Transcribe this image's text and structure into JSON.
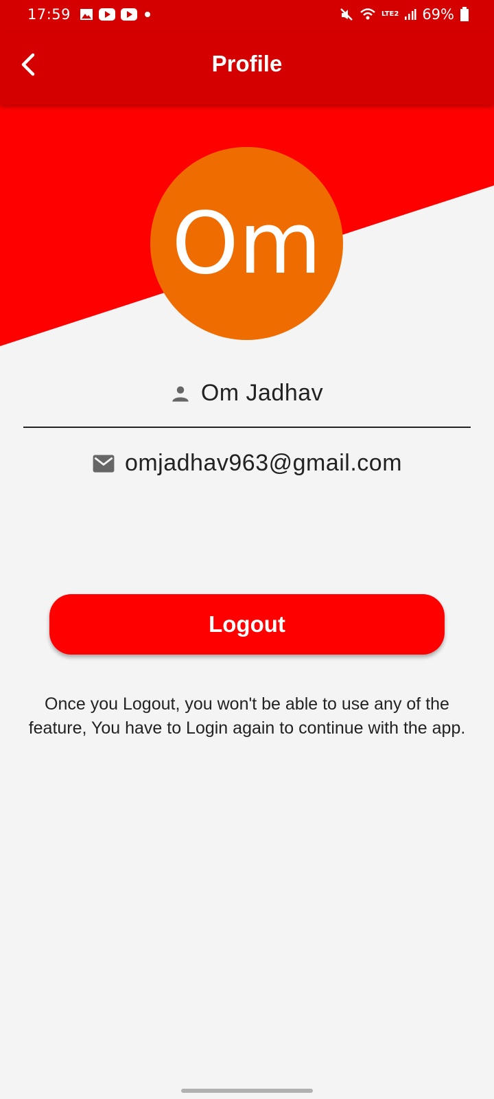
{
  "status_bar": {
    "time": "17:59",
    "battery": "69%",
    "network": "LTE2",
    "notification_icons": [
      "gallery-icon",
      "youtube-icon",
      "youtube-icon",
      "dot-icon"
    ]
  },
  "app_bar": {
    "title": "Profile",
    "back_icon": "chevron-left-icon"
  },
  "profile": {
    "avatar_text": "Om",
    "name": "Om Jadhav",
    "email": "omjadhav963@gmail.com"
  },
  "actions": {
    "logout_label": "Logout"
  },
  "info": {
    "message": "Once you Logout, you won't be able to use any of the feature, You have to Login again to continue with the app."
  },
  "colors": {
    "app_bar": "#d40000",
    "hero_red": "#ff0000",
    "avatar_bg": "#ef6c00",
    "button_bg": "#ff0000",
    "background": "#f4f4f4"
  }
}
